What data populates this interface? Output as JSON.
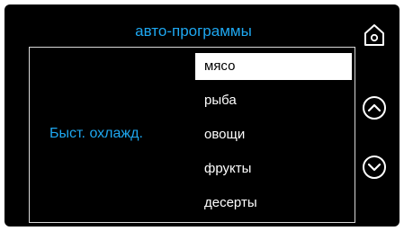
{
  "header": {
    "title": "авто-программы"
  },
  "mode": {
    "label": "Быст. охлажд."
  },
  "menu": {
    "items": [
      {
        "label": "мясо",
        "selected": true
      },
      {
        "label": "рыба",
        "selected": false
      },
      {
        "label": "овощи",
        "selected": false
      },
      {
        "label": "фрукты",
        "selected": false
      },
      {
        "label": "десерты",
        "selected": false
      }
    ]
  },
  "controls": {
    "home_icon": "home-icon",
    "up_icon": "chevron-up-circle-icon",
    "down_icon": "chevron-down-circle-icon"
  },
  "colors": {
    "accent": "#1ea7f0",
    "background": "#000000",
    "text": "#ffffff",
    "selected_bg": "#ffffff",
    "selected_text": "#000000"
  }
}
